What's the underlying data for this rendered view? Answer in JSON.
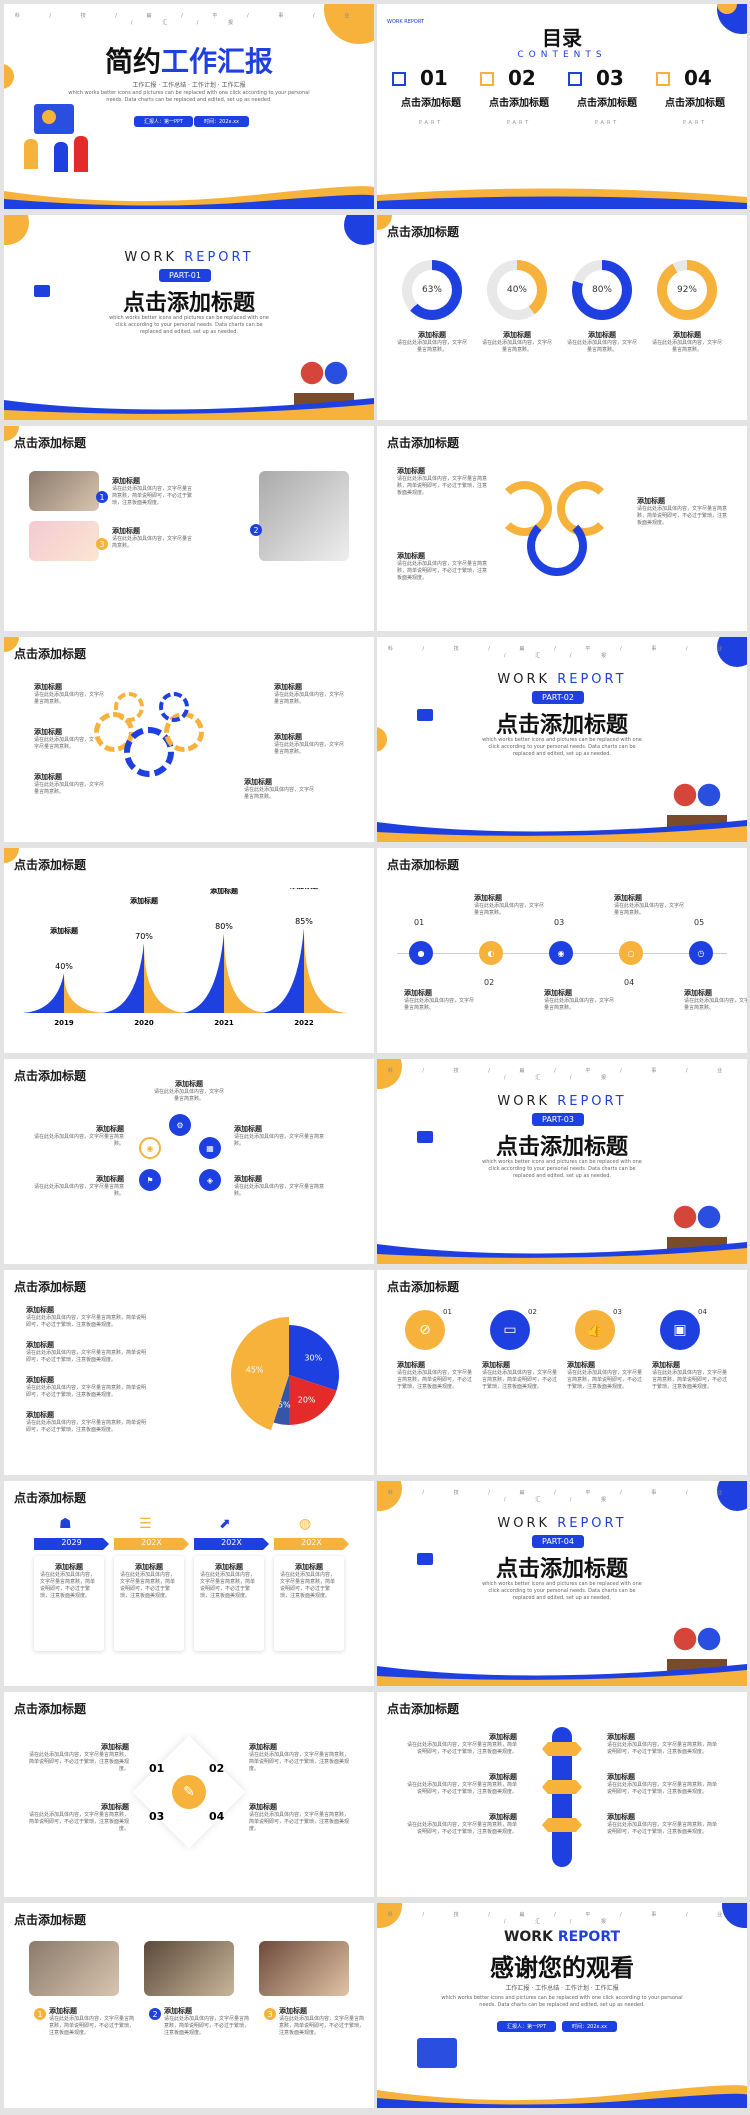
{
  "colors": {
    "blue": "#1f40e0",
    "yellow": "#f7b23b",
    "red": "#e52a2a",
    "dark": "#222222"
  },
  "generic_title": "点击添加标题",
  "add_title": "添加标题",
  "body_short": "请在此处添加具体内容，文字尽量言简意赅。",
  "body_long": "请在此处添加具体内容，文字尽量言简意赅，简单说明即可，不必过于繁琐，注意板面美观度。",
  "en_body": "which works better icons and pictures can be replaced with one click according to your personal needs. Data charts can be replaced and edited, set up as needed.",
  "nav": "科 / 技 / 扁 / 平 / 事 / 业 / 汇 / 报",
  "work": "WORK",
  "report": "REPORT",
  "cover": {
    "title_a": "简约",
    "title_b": "工作汇报",
    "subtitle": "工作汇报 · 工作总结 · 工作计划 · 工作汇报",
    "reporter": "汇报人：第一PPT",
    "time": "时间：202x.xx",
    "slogan": "新起点 新征程"
  },
  "toc": {
    "title": "目录",
    "en": "CONTENTS",
    "items": [
      {
        "num": "01",
        "label": "点击添加标题",
        "sub": "PART"
      },
      {
        "num": "02",
        "label": "点击添加标题",
        "sub": "PART"
      },
      {
        "num": "03",
        "label": "点击添加标题",
        "sub": "PART"
      },
      {
        "num": "04",
        "label": "点击添加标题",
        "sub": "PART"
      }
    ]
  },
  "parts": [
    "PART-01",
    "PART-02",
    "PART-03",
    "PART-04"
  ],
  "rings": [
    {
      "value": "63%"
    },
    {
      "value": "40%"
    },
    {
      "value": "80%"
    },
    {
      "value": "92%"
    }
  ],
  "rings_val": [
    0.63,
    0.4,
    0.8,
    0.92
  ],
  "timeline_years": [
    "2019",
    "2020",
    "2021",
    "2022"
  ],
  "timeline_pcts": [
    "40%",
    "70%",
    "80%",
    "85%"
  ],
  "steps": [
    "01",
    "02",
    "03",
    "04",
    "05"
  ],
  "pie": {
    "labels": [
      "30%",
      "20%",
      "5%",
      "45%"
    ],
    "values": [
      30,
      20,
      5,
      45
    ]
  },
  "years_bar": [
    "2029",
    "202X",
    "202X",
    "202X"
  ],
  "diamond": [
    "01",
    "02",
    "03",
    "04"
  ],
  "thanks": {
    "title": "感谢您的观看",
    "subtitle": "工作汇报 · 工作总结 · 工作计划 · 工作汇报"
  }
}
